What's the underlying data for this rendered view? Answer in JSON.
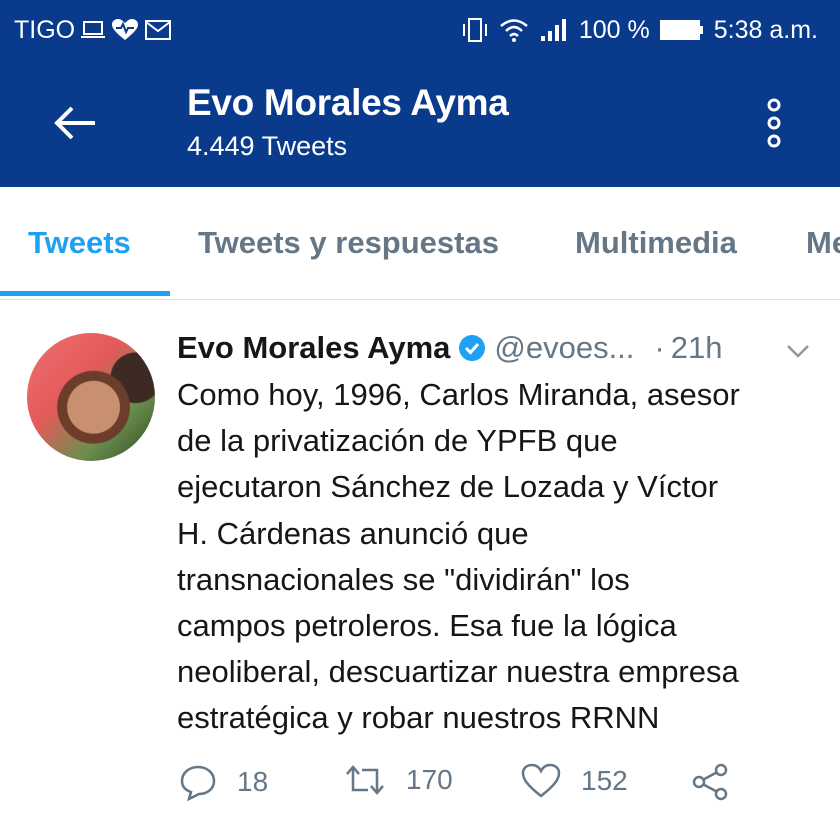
{
  "status_bar": {
    "carrier": "TIGO",
    "battery": "100 %",
    "time": "5:38 a.m.",
    "icons": [
      "laptop-icon",
      "heart-pulse-icon",
      "mail-icon",
      "vibrate-icon",
      "wifi-icon",
      "signal-icon",
      "battery-icon"
    ]
  },
  "header": {
    "title": "Evo Morales Ayma",
    "subtitle": "4.449 Tweets"
  },
  "tabs": [
    {
      "label": "Tweets",
      "active": true
    },
    {
      "label": "Tweets y respuestas",
      "active": false
    },
    {
      "label": "Multimedia",
      "active": false
    },
    {
      "label": "Me",
      "active": false
    }
  ],
  "tweet": {
    "author": "Evo Morales Ayma",
    "handle": "@evoes...",
    "dot": "·",
    "time": "21h",
    "text": "Como hoy, 1996, Carlos Miranda, asesor\nde la privatización de YPFB que\nejecutaron Sánchez de Lozada y Víctor\nH. Cárdenas anunció que\ntransnacionales se \"dividirán\" los\ncampos petroleros. Esa fue la lógica\nneoliberal, descuartizar nuestra empresa\nestratégica y robar nuestros RRNN",
    "replies": "18",
    "retweets": "170",
    "likes": "152"
  },
  "colors": {
    "header_bg": "#0a3a8c",
    "accent": "#1da1f2",
    "secondary_text": "#657786"
  }
}
